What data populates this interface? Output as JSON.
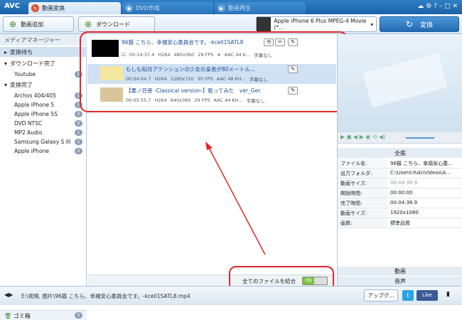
{
  "app": {
    "logo": "AVC"
  },
  "tabs": [
    {
      "label": "動画変換"
    },
    {
      "label": "DVD作成"
    },
    {
      "label": "動画再生"
    }
  ],
  "window": {
    "controls": "☁ ⚙ ? – □ ✕"
  },
  "toolbar": {
    "add_label": "動画追加",
    "download_label": "ダウンロード",
    "profile": "Apple iPhone 6 Plus MPEG-4 Movie (*...",
    "convert_label": "変換"
  },
  "sidebar": {
    "title": "メディアマネージャー",
    "sections": [
      {
        "label": "変換待ち"
      },
      {
        "label": "ダウンロード完了",
        "items": [
          {
            "name": "Youtube",
            "count": "1"
          }
        ]
      },
      {
        "label": "変換完了",
        "items": [
          {
            "name": "Archos 404/405",
            "count": "1"
          },
          {
            "name": "Apple iPhone 5",
            "count": "1"
          },
          {
            "name": "Apple iPhone 5S",
            "count": "2"
          },
          {
            "name": "DVD NTSC",
            "count": "2"
          },
          {
            "name": "MP2 Audio",
            "count": "1"
          },
          {
            "name": "Samsung Galaxy S III",
            "count": "1"
          },
          {
            "name": "Apple iPhone",
            "count": "2"
          }
        ]
      }
    ],
    "trash_label": "ゴミ箱",
    "trash_count": "5"
  },
  "files": [
    {
      "title": "96猫 こちら、幸福安心委員会です。-kcell1SATL8",
      "duration": "00:14:37.4",
      "codec": "H264",
      "res": "480x360",
      "fps": "29 FPS",
      "audio": "AAC 44 K...",
      "subtitle": "字幕なし"
    },
    {
      "title": "もしも知月アテンションの少女の身長が80メートル...",
      "duration": "00:04:04.7",
      "codec": "H264",
      "res": "1280x720",
      "fps": "30 FPS",
      "audio": "AAC 48 KH...",
      "subtitle": "字幕なし"
    },
    {
      "title": "【悪ノ召使 -Classical version-】歌ってみた　ver_Ger...",
      "duration": "00:05:55.7",
      "codec": "H264",
      "res": "640x360",
      "fps": "29 FPS",
      "audio": "AAC 44 KH...",
      "subtitle": "字幕なし"
    }
  ],
  "merge": {
    "label": "全てのファイルを結合",
    "toggle": "ON"
  },
  "props": {
    "header": "全般",
    "rows": [
      {
        "k": "ファイル名:",
        "v": "96猫 こちら、幸福安心委..."
      },
      {
        "k": "出力フォルダ:",
        "v": "C:\\Users\\Yuki\\Videos\\A..."
      },
      {
        "k": "動画サイズ:",
        "v": "00:04:36.9"
      },
      {
        "k": "開始時間:",
        "v": "00:00:00"
      },
      {
        "k": "完了時間:",
        "v": "00:04:36.9"
      },
      {
        "k": "動画サイズ:",
        "v": "1920x1080"
      },
      {
        "k": "画質:",
        "v": "標準品質"
      }
    ],
    "video_label": "動画",
    "audio_label": "音声"
  },
  "status": {
    "path": "E:\\视频, 图片\\96猫 こちら、幸福安心委員会です。-kcell1SATL8.mp4",
    "upgrade": "アップグ...",
    "like": "Like"
  }
}
